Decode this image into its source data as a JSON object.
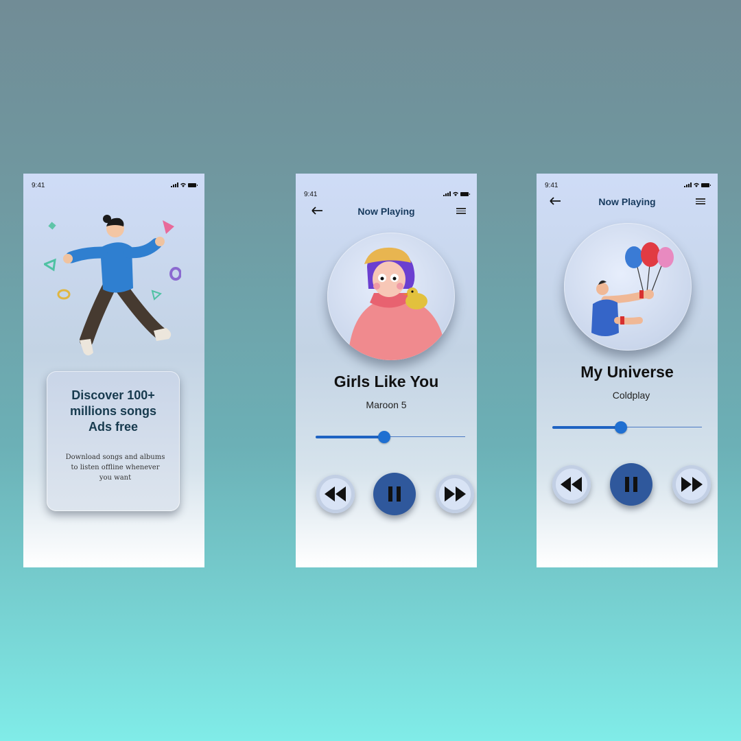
{
  "colors": {
    "accent": "#1f6fd1",
    "play_button": "#2f589c",
    "title_text": "#173a5e"
  },
  "onboarding": {
    "status_time": "9:41",
    "heading": "Discover 100+\nmillions songs\nAds free",
    "body": "Download  songs and albums\nto listen offline  whenever\nyou  want"
  },
  "player1": {
    "status_time": "9:41",
    "header_title": "Now Playing",
    "song_title": "Girls Like You",
    "artist": "Maroon 5",
    "progress": 0.46,
    "controls": [
      "rewind-icon",
      "pause-icon",
      "fast-forward-icon"
    ]
  },
  "player2": {
    "status_time": "9:41",
    "header_title": "Now Playing",
    "song_title": "My Universe",
    "artist": "Coldplay",
    "progress": 0.46,
    "controls": [
      "rewind-icon",
      "pause-icon",
      "fast-forward-icon"
    ]
  }
}
